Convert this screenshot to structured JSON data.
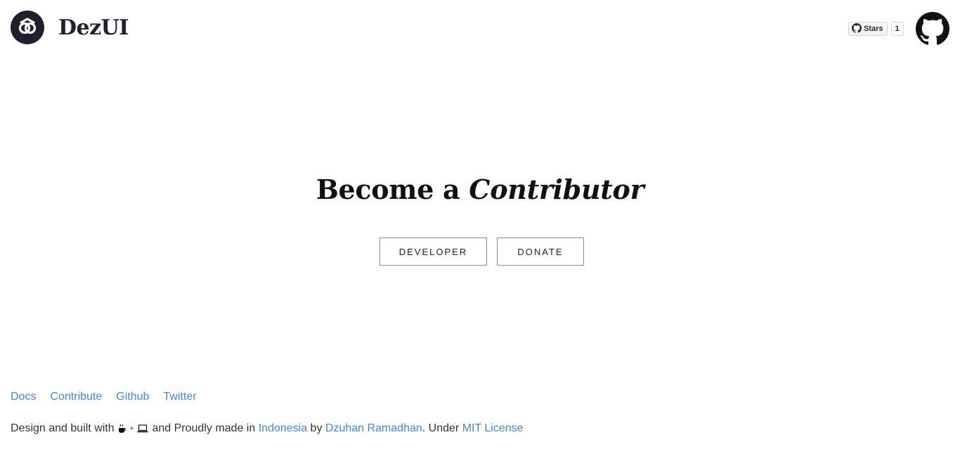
{
  "header": {
    "brand": "DezUI",
    "stars_label": "Stars",
    "stars_count": "1"
  },
  "hero": {
    "title_plain": "Become a ",
    "title_emphasis": "Contributor",
    "buttons": {
      "developer": "DEVELOPER",
      "donate": "DONATE"
    }
  },
  "footer": {
    "links": [
      "Docs",
      "Contribute",
      "Github",
      "Twitter"
    ],
    "credit": {
      "prefix": "Design and built with",
      "middle": "and Proudly made in",
      "country": "Indonesia",
      "by": "by",
      "author": "Dzuhan Ramadhan",
      "under": ". Under",
      "license": "MIT License"
    }
  },
  "colors": {
    "link": "#4a86c5",
    "logo_bg": "#1f1f2e"
  }
}
